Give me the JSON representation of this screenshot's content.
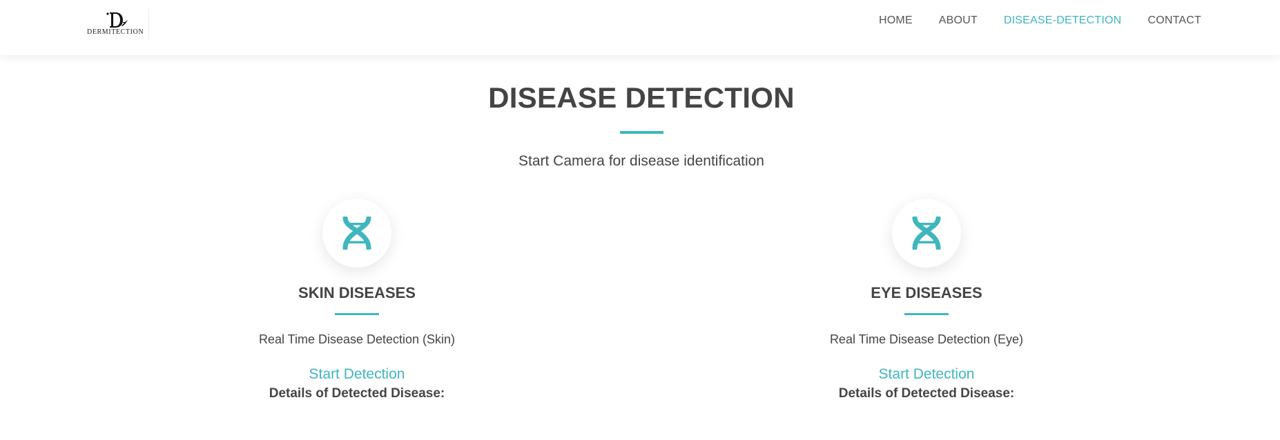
{
  "brand": {
    "logo_text": "DERMITECTION",
    "accent_color": "#3fb6bd",
    "text_color": "#444444"
  },
  "nav": {
    "items": [
      {
        "label": "HOME",
        "active": false
      },
      {
        "label": "ABOUT",
        "active": false
      },
      {
        "label": "DISEASE-DETECTION",
        "active": true
      },
      {
        "label": "CONTACT",
        "active": false
      }
    ]
  },
  "section": {
    "title": "DISEASE DETECTION",
    "subtitle": "Start Camera for disease identification"
  },
  "cards": [
    {
      "icon": "dna-icon",
      "title": "SKIN DISEASES",
      "description": "Real Time Disease Detection (Skin)",
      "link_label": "Start Detection",
      "details_label": "Details of Detected Disease:"
    },
    {
      "icon": "dna-icon",
      "title": "EYE DISEASES",
      "description": "Real Time Disease Detection (Eye)",
      "link_label": "Start Detection",
      "details_label": "Details of Detected Disease:"
    }
  ]
}
